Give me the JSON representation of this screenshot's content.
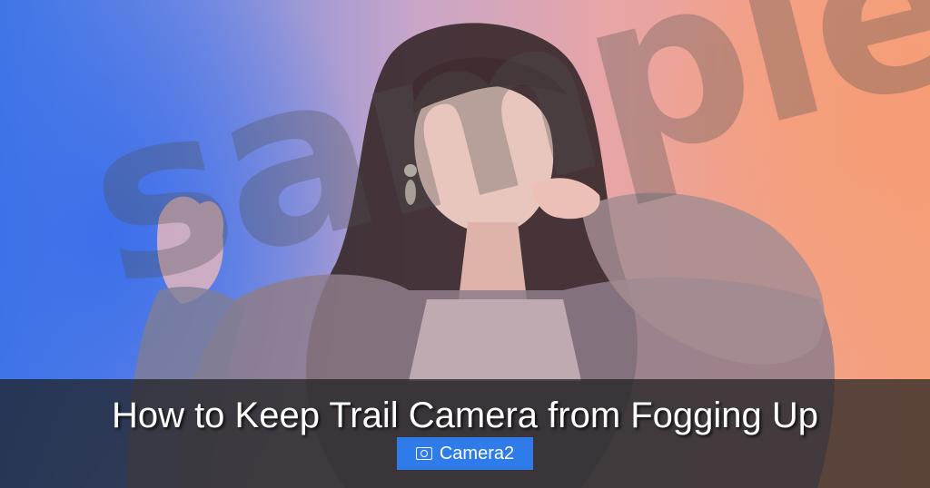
{
  "image": {
    "subject": "portrait photo",
    "background_colors": [
      "#3f77e6",
      "#c9a6c8",
      "#f4a07c"
    ]
  },
  "watermark": {
    "text": "sample"
  },
  "caption": {
    "title": "How to Keep Trail Camera from Fogging Up",
    "category_label": "Camera2",
    "category_icon": "camera-icon",
    "badge_color": "#2f7bea"
  }
}
